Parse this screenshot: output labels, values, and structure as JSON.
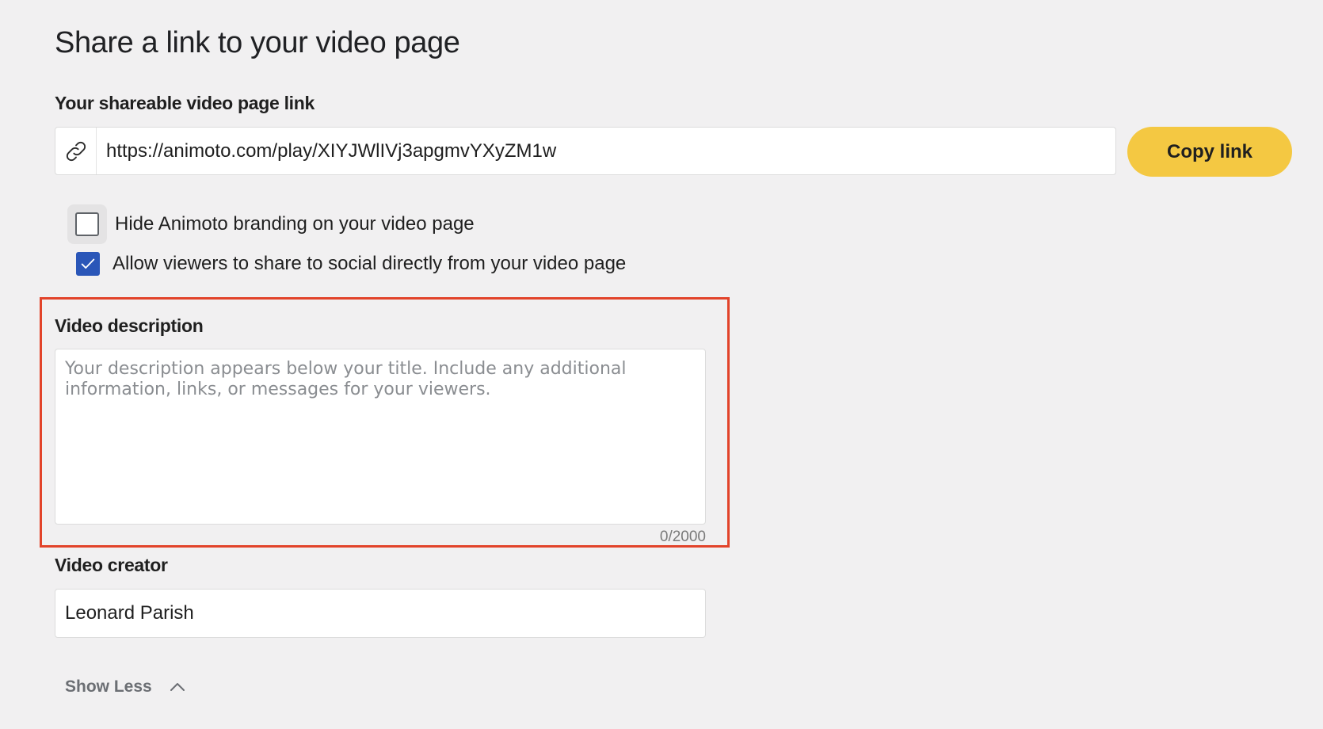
{
  "page": {
    "title": "Share a link to your video page"
  },
  "link_section": {
    "label": "Your shareable video page link",
    "url": "https://animoto.com/play/XIYJWlIVj3apgmvYXyZM1w",
    "copy_button": "Copy link",
    "icon": "link-icon"
  },
  "options": {
    "hide_branding": {
      "label": "Hide Animoto branding on your video page",
      "checked": false
    },
    "allow_social": {
      "label": "Allow viewers to share to social directly from your video page",
      "checked": true
    }
  },
  "description": {
    "label": "Video description",
    "placeholder": "Your description appears below your title. Include any additional information, links, or messages for your viewers.",
    "value": "",
    "counter": "0/2000"
  },
  "creator": {
    "label": "Video creator",
    "value": "Leonard Parish"
  },
  "toggle": {
    "label": "Show Less",
    "icon": "chevron-up-icon"
  },
  "colors": {
    "background": "#f1f0f1",
    "accent_button": "#f4c842",
    "checkbox_checked": "#2a56b8",
    "highlight": "#e2432a"
  }
}
